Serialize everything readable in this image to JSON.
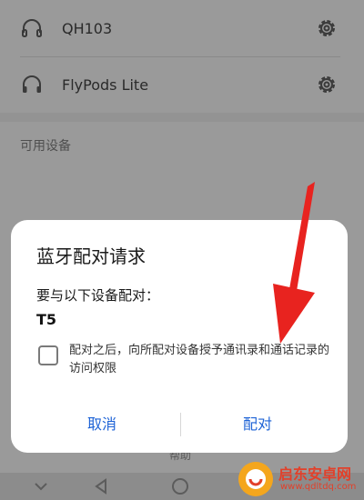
{
  "paired_devices": [
    {
      "name": "QH103",
      "icon": "headphones-icon"
    },
    {
      "name": "FlyPods Lite",
      "icon": "headphones-icon"
    }
  ],
  "available_section_label": "可用设备",
  "help_label": "帮助",
  "dialog": {
    "title": "蓝牙配对请求",
    "message": "要与以下设备配对：",
    "device_name": "T5",
    "checkbox_label": "配对之后，向所配对设备授予通讯录和通话记录的访问权限",
    "checkbox_checked": false,
    "cancel_label": "取消",
    "pair_label": "配对"
  },
  "watermark": {
    "title": "启东安卓网",
    "url": "www.qdltdq.com"
  },
  "colors": {
    "accent": "#1e63d6",
    "arrow": "#e8231f",
    "overlay": "#9a9a9a"
  }
}
